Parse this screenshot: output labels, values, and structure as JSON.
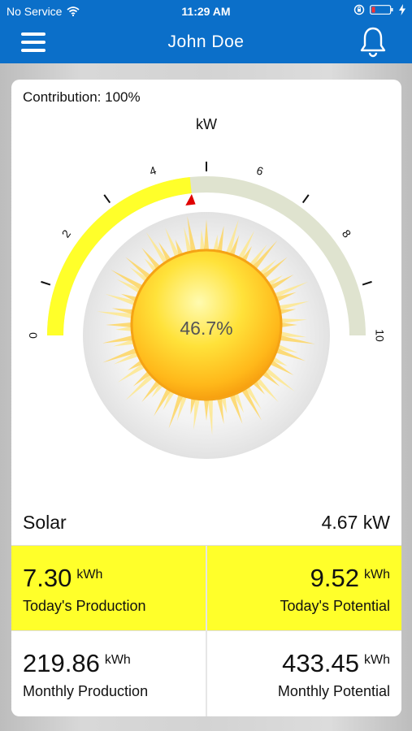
{
  "status_bar": {
    "carrier": "No Service",
    "time": "11:29 AM"
  },
  "nav": {
    "title": "John Doe"
  },
  "contribution": "Contribution: 100%",
  "gauge": {
    "unit_label": "kW",
    "center_text": "46.7%",
    "ticks": [
      "0",
      "2",
      "4",
      "6",
      "8",
      "10"
    ],
    "min": 0,
    "max": 10,
    "value": 4.67,
    "fill_color": "#ffff2a",
    "track_color": "#dfe3cf",
    "marker_color": "#e00000"
  },
  "solar": {
    "label": "Solar",
    "value": "4.67 kW"
  },
  "tiles": {
    "today_production": {
      "value": "7.30",
      "unit": "kWh",
      "caption": "Today's Production"
    },
    "today_potential": {
      "value": "9.52",
      "unit": "kWh",
      "caption": "Today's Potential"
    },
    "monthly_production": {
      "value": "219.86",
      "unit": "kWh",
      "caption": "Monthly Production"
    },
    "monthly_potential": {
      "value": "433.45",
      "unit": "kWh",
      "caption": "Monthly Potential"
    }
  },
  "colors": {
    "brand_blue": "#0b6fc9",
    "highlight_yellow": "#ffff2a"
  }
}
